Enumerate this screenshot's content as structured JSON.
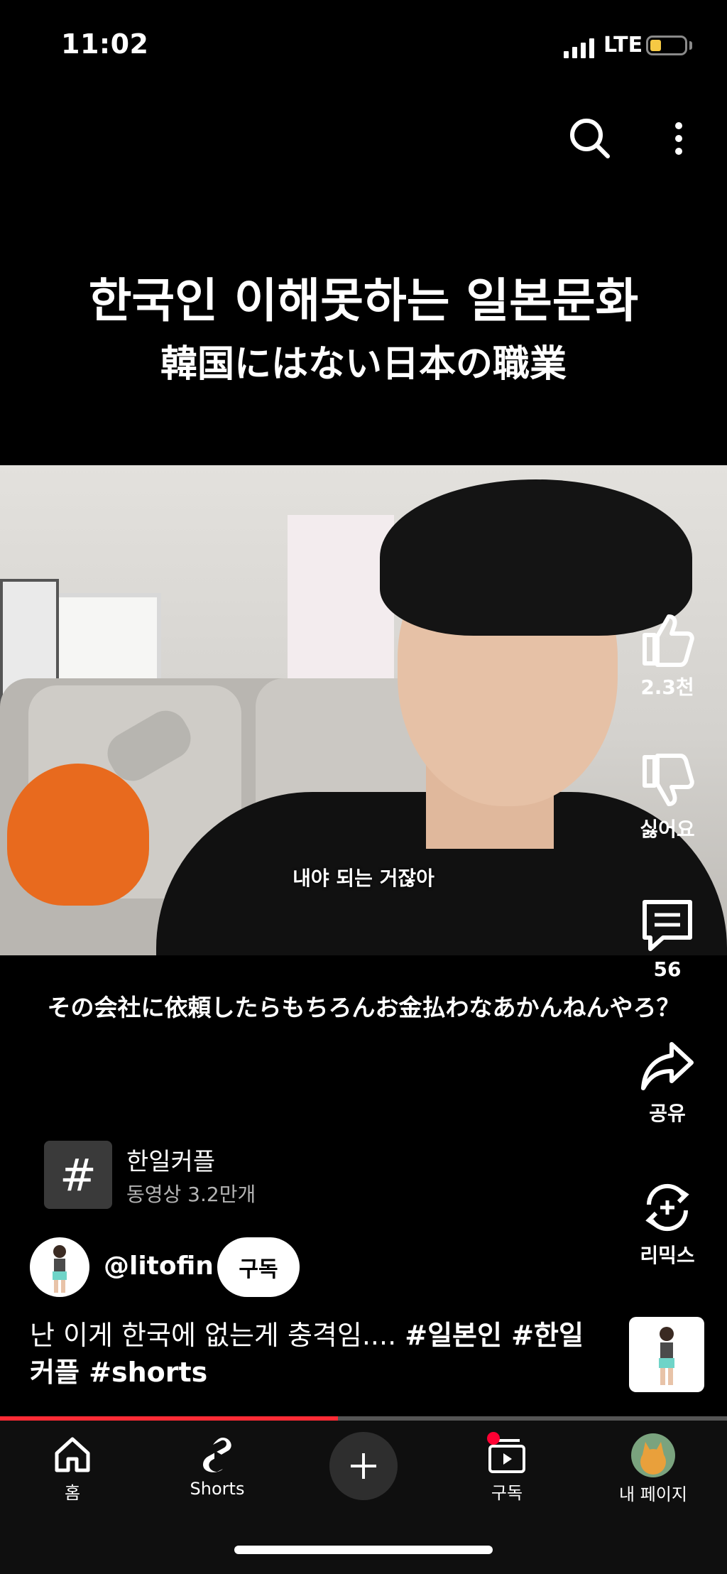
{
  "status_bar": {
    "time": "11:02",
    "network": "LTE"
  },
  "video": {
    "title": "한국인 이해못하는 일본문화",
    "subtitle": "韓国にはない日本の職業",
    "inner_caption": "내야 되는 거잖아",
    "translated_caption": "その会社に依頼したらもちろんお金払わなあかんねんやろ？",
    "progress_fraction": 0.465
  },
  "actions": {
    "like_label": "2.3천",
    "dislike_label": "싫어요",
    "comment_label": "56",
    "share_label": "공유",
    "remix_label": "리믹스"
  },
  "hashtag": {
    "symbol": "#",
    "name": "한일커플",
    "count": "동영상 3.2만개"
  },
  "channel": {
    "handle": "@litofin",
    "subscribe_label": "구독"
  },
  "description": {
    "text": "난 이게 한국에 없는게 충격임.... ",
    "tags": "#일본인 #한일커플 #shorts"
  },
  "bottom_nav": {
    "home": "홈",
    "shorts": "Shorts",
    "subscriptions": "구독",
    "my_page": "내 페이지"
  },
  "colors": {
    "accent": "#ff0033",
    "battery": "#f6c944"
  }
}
